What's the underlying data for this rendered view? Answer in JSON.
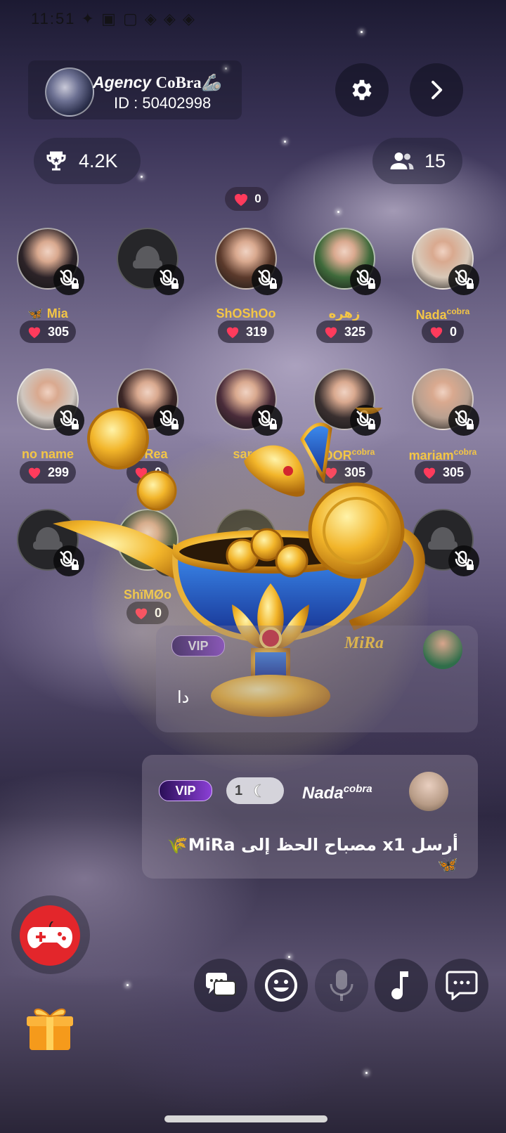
{
  "status_bar": {
    "text": "11:51 ✦ ▣ ▢ ◈ ◈ ◈"
  },
  "room": {
    "name_italic": "Agency",
    "name_brand": "CoBra",
    "name_suffix": "🦾",
    "id_label": "ID : 50402998"
  },
  "header_stats": {
    "trophy_value": "4.2K",
    "members_count": "15"
  },
  "room_hearts": "0",
  "seats": [
    {
      "name": "Mia",
      "prefix": "🦋",
      "hearts": "305",
      "photo": "#2c2328"
    },
    {
      "name": "",
      "hearts": "",
      "photo": ""
    },
    {
      "name": "ShOShOo",
      "hearts": "319",
      "photo": "#5b3a2c"
    },
    {
      "name": "زهره",
      "hearts": "325",
      "photo": "#3f6a3b"
    },
    {
      "name": "Nada",
      "name_sup": "cobra",
      "hearts": "0",
      "photo": "#d8c8b8"
    },
    {
      "name": "no name",
      "hearts": "299",
      "photo": "#cfc7c0"
    },
    {
      "name": "DoRea",
      "hearts": "0",
      "photo": "#3b2626"
    },
    {
      "name": "sara",
      "hearts": "",
      "photo": "#4a2c3a"
    },
    {
      "name": "NOOR",
      "name_sup": "cobra",
      "hearts": "305",
      "photo": "#3a3030"
    },
    {
      "name": "mariam",
      "name_sup": "cobra",
      "hearts": "305",
      "photo": "#b8a090"
    },
    {
      "name": "",
      "hearts": "",
      "photo": ""
    },
    {
      "name": "ShïMØo",
      "hearts": "0",
      "photo": "#3d4f3a"
    },
    {
      "name": "",
      "hearts": "",
      "photo": ""
    },
    {
      "name": "",
      "hearts": "",
      "photo": ""
    },
    {
      "name": "",
      "hearts": "",
      "photo": ""
    }
  ],
  "chat": [
    {
      "badge": "VIP",
      "sender": "MiRa",
      "text": "دا"
    },
    {
      "badge": "VIP",
      "level": "1",
      "sender": "Nada",
      "sender_sup": "cobra",
      "text": "أرسل x1 مصباح الحظ إلى MiRa🌾🦋"
    }
  ],
  "toolbar": {
    "icons": [
      "game-icon",
      "gift-icon",
      "messages-icon",
      "emoji-icon",
      "mic-icon",
      "music-icon",
      "chat-icon"
    ]
  },
  "colors": {
    "accent_gold": "#f4c645",
    "game_red": "#e3262b",
    "gift_orange": "#f59a1b"
  }
}
